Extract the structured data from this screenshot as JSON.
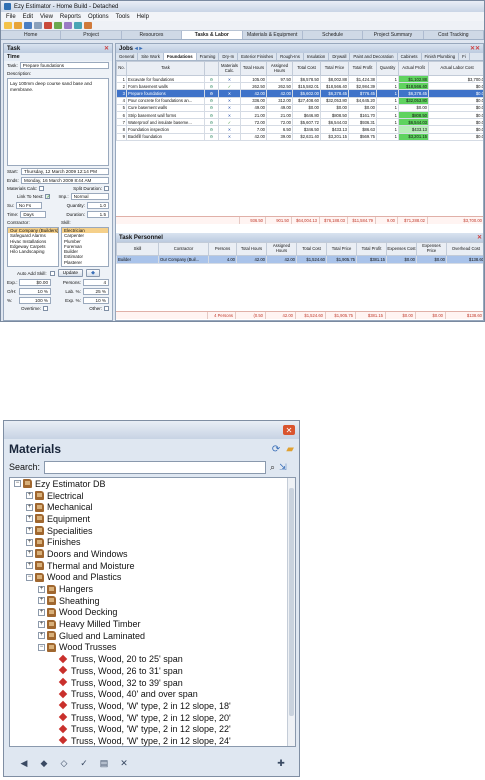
{
  "app": {
    "title": "Ezy Estimator - Home Build - Detached",
    "menu": [
      "File",
      "Edit",
      "View",
      "Reports",
      "Options",
      "Tools",
      "Help"
    ],
    "nav_tabs": [
      {
        "label": "Home",
        "active": false
      },
      {
        "label": "Project",
        "active": false
      },
      {
        "label": "Resources",
        "active": false
      },
      {
        "label": "Tasks & Labor",
        "active": true
      },
      {
        "label": "Materials & Equipment",
        "active": false
      },
      {
        "label": "Schedule",
        "active": false
      },
      {
        "label": "Project Summary",
        "active": false
      },
      {
        "label": "Cost Tracking",
        "active": false
      }
    ]
  },
  "task_panel": {
    "heading": "Task",
    "section": "Time",
    "task_label": "Task:",
    "task_value": "Prepare foundations",
    "description_label": "Description:",
    "description_value": "Lay 100mm deep course sand base and membrane.",
    "start_label": "Start:",
    "start_value": "Thursday, 12 March 2009 12:14 PM",
    "ends_label": "Ends:",
    "ends_value": "Monday, 16 March 2009 8:44 AM",
    "materials_calc_label": "Materials Calc:",
    "split_duration_label": "Split Duration:",
    "link_to_next_label": "Link To Next:",
    "imp_label": "Imp.:",
    "imp_value": "Normal",
    "su_label": "Su:",
    "su_value": "No Fs",
    "quantity_label": "Quantity:",
    "quantity_value": "1.0",
    "time_label": "Time:",
    "time_value": "Days",
    "duration_label": "Duration:",
    "duration_value": "1.5",
    "contractor_label": "Contractor:",
    "skill_label": "Skill:",
    "contractors": [
      "Our Company (Builders)",
      "Safeguard Alarms",
      "Hivac Installations",
      "Edgeway Carpets",
      "Hilo Landscaping"
    ],
    "skills": [
      "Electrician",
      "Carpenter",
      "Plumber",
      "Foreman",
      "Builder",
      "Estimator",
      "Plasterer"
    ],
    "auto_add_skill_label": "Auto Add Skill:",
    "update_label": "Update",
    "exp_label": "Exp.:",
    "exp_value": "$0.00",
    "persons_label": "Persons:",
    "persons_value": "4",
    "o_h_label": "O/H:",
    "o_h_value": "10 %",
    "lab_pct_label": "Lab. %:",
    "lab_pct_value": "25 %",
    "pct_label": "%:",
    "pct_value": "100 %",
    "exp_pct_label": "Exp. %:",
    "exp_pct_value": "10 %",
    "overtime_label": "Overtime:",
    "other_label": "Other:"
  },
  "jobs_panel": {
    "heading": "Jobs",
    "tabs": [
      "General",
      "Site Work",
      "Foundations",
      "Framing",
      "Dry-In",
      "Exterior Finishes",
      "Rough-Ins",
      "Insulation",
      "Drywall",
      "Paint and Decoration",
      "Cabinets",
      "Finish Plumbing",
      "Fi"
    ],
    "active_tab": "Foundations",
    "columns": [
      "No.",
      "Task",
      "",
      "Materials Calc.",
      "Total Hours",
      "Assigned Hours",
      "Total Cost",
      "Total Price",
      "Total Profit",
      "Quantity",
      "Actual Profit",
      "Actual Labor Cost"
    ],
    "rows": [
      {
        "no": "1",
        "task": "Excavate for foundations",
        "calc": "✕",
        "hours": "105.00",
        "assigned": "97.50",
        "cost": "$6,578.50",
        "price": "$8,002.88",
        "profit": "$1,424.38",
        "qty": "1",
        "actual_profit": "$1,102.88",
        "labor": "$3,700.0",
        "sel": false,
        "hl": "green"
      },
      {
        "no": "2",
        "task": "Form basement walls",
        "calc": "✓",
        "hours": "262.50",
        "assigned": "262.50",
        "cost": "$15,582.01",
        "price": "$18,566.40",
        "profit": "$2,984.39",
        "qty": "1",
        "actual_profit": "$18,566.40",
        "labor": "$0.0",
        "sel": false,
        "hl": "green"
      },
      {
        "no": "3",
        "task": "Prepare foundations",
        "calc": "✕",
        "hours": "42.00",
        "assigned": "42.00",
        "cost": "$5,602.00",
        "price": "$6,378.45",
        "profit": "$776.45",
        "qty": "1",
        "actual_profit": "$6,378.45",
        "labor": "$0.0",
        "sel": true,
        "hl": "green"
      },
      {
        "no": "4",
        "task": "Pour concrete for foundations an...",
        "calc": "✕",
        "hours": "336.00",
        "assigned": "312.00",
        "cost": "$27,408.60",
        "price": "$32,053.80",
        "profit": "$4,645.20",
        "qty": "1",
        "actual_profit": "$32,053.80",
        "labor": "$0.0",
        "sel": false,
        "hl": "green"
      },
      {
        "no": "5",
        "task": "Cure basement walls",
        "calc": "✕",
        "hours": "49.00",
        "assigned": "49.00",
        "cost": "$0.00",
        "price": "$0.00",
        "profit": "$0.00",
        "qty": "1",
        "actual_profit": "$0.00",
        "labor": "$0.0",
        "sel": false,
        "hl": ""
      },
      {
        "no": "6",
        "task": "Strip basement wall forms",
        "calc": "✕",
        "hours": "21.00",
        "assigned": "21.00",
        "cost": "$646.80",
        "price": "$808.50",
        "profit": "$161.70",
        "qty": "1",
        "actual_profit": "$808.50",
        "labor": "$0.0",
        "sel": false,
        "hl": "green"
      },
      {
        "no": "7",
        "task": "Waterproof and insulate baseme...",
        "calc": "✓",
        "hours": "72.00",
        "assigned": "72.00",
        "cost": "$5,607.72",
        "price": "$6,544.03",
        "profit": "$936.31",
        "qty": "1",
        "actual_profit": "$6,544.03",
        "labor": "$0.0",
        "sel": false,
        "hl": "green"
      },
      {
        "no": "8",
        "task": "Foundation inspection",
        "calc": "✕",
        "hours": "7.00",
        "assigned": "6.50",
        "cost": "$346.50",
        "price": "$433.13",
        "profit": "$86.63",
        "qty": "1",
        "actual_profit": "$433.13",
        "labor": "$0.0",
        "sel": false,
        "hl": "ltgreen"
      },
      {
        "no": "9",
        "task": "Backfill foundation",
        "calc": "✕",
        "hours": "42.00",
        "assigned": "39.00",
        "cost": "$2,631.40",
        "price": "$3,201.15",
        "profit": "$569.75",
        "qty": "1",
        "actual_profit": "$3,201.15",
        "labor": "$0.0",
        "sel": false,
        "hl": "green"
      }
    ],
    "totals": [
      "",
      "936.50",
      "901.50",
      "$64,004.13",
      "$76,188.03",
      "$11,584.79",
      "9.00",
      "$71,288.02",
      "$3,700.00"
    ]
  },
  "personnel_panel": {
    "heading": "Task Personnel",
    "columns": [
      "Skill",
      "Contractor",
      "Persons",
      "Total Hours",
      "Assigned Hours",
      "Total Cost",
      "Total Price",
      "Total Profit",
      "Expenses Cost",
      "Expenses Price",
      "Overhead Cost"
    ],
    "rows": [
      {
        "skill": "Builder",
        "contractor": "Our Company (Buil...",
        "persons": "4.00",
        "hours": "42.00",
        "assigned": "42.00",
        "cost": "$1,524.60",
        "price": "$1,905.75",
        "profit": "$381.15",
        "exp_cost": "$0.00",
        "exp_price": "$0.00",
        "overhead": "$138.60"
      }
    ],
    "totals": [
      "",
      "4 Persons",
      "(0.50",
      "42.00",
      "$1,524.60",
      "$1,905.75",
      "$381.15",
      "$0.00",
      "$0.00",
      "$138.60"
    ]
  },
  "materials": {
    "title": "Materials",
    "search_label": "Search:",
    "search_value": "",
    "tree": [
      {
        "depth": 0,
        "label": "Ezy Estimator DB",
        "exp": "−",
        "kind": "folder"
      },
      {
        "depth": 1,
        "label": "Electrical",
        "exp": "+",
        "kind": "folder"
      },
      {
        "depth": 1,
        "label": "Mechanical",
        "exp": "+",
        "kind": "folder"
      },
      {
        "depth": 1,
        "label": "Equipment",
        "exp": "+",
        "kind": "folder"
      },
      {
        "depth": 1,
        "label": "Specialities",
        "exp": "+",
        "kind": "folder"
      },
      {
        "depth": 1,
        "label": "Finishes",
        "exp": "+",
        "kind": "folder"
      },
      {
        "depth": 1,
        "label": "Doors and Windows",
        "exp": "+",
        "kind": "folder"
      },
      {
        "depth": 1,
        "label": "Thermal and Moisture",
        "exp": "+",
        "kind": "folder"
      },
      {
        "depth": 1,
        "label": "Wood and Plastics",
        "exp": "−",
        "kind": "folder"
      },
      {
        "depth": 2,
        "label": "Hangers",
        "exp": "+",
        "kind": "folder"
      },
      {
        "depth": 2,
        "label": "Sheathing",
        "exp": "+",
        "kind": "folder"
      },
      {
        "depth": 2,
        "label": "Wood Decking",
        "exp": "+",
        "kind": "folder"
      },
      {
        "depth": 2,
        "label": "Heavy Milled Timber",
        "exp": "+",
        "kind": "folder"
      },
      {
        "depth": 2,
        "label": "Glued and Laminated",
        "exp": "+",
        "kind": "folder"
      },
      {
        "depth": 2,
        "label": "Wood Trusses",
        "exp": "−",
        "kind": "folder"
      },
      {
        "depth": 3,
        "label": "Truss, Wood, 20 to 25' span",
        "exp": "",
        "kind": "item"
      },
      {
        "depth": 3,
        "label": "Truss, Wood, 26 to 31' span",
        "exp": "",
        "kind": "item"
      },
      {
        "depth": 3,
        "label": "Truss, Wood, 32 to 39' span",
        "exp": "",
        "kind": "item"
      },
      {
        "depth": 3,
        "label": "Truss, Wood, 40' and over span",
        "exp": "",
        "kind": "item"
      },
      {
        "depth": 3,
        "label": "Truss, Wood, 'W' type, 2 in 12 slope, 18'",
        "exp": "",
        "kind": "item"
      },
      {
        "depth": 3,
        "label": "Truss, Wood, 'W' type, 2 in 12 slope, 20'",
        "exp": "",
        "kind": "item"
      },
      {
        "depth": 3,
        "label": "Truss, Wood, 'W' type, 2 in 12 slope, 22'",
        "exp": "",
        "kind": "item"
      },
      {
        "depth": 3,
        "label": "Truss, Wood, 'W' type, 2 in 12 slope, 24'",
        "exp": "",
        "kind": "item"
      },
      {
        "depth": 3,
        "label": "Truss, Wood, 'W' type, 2 in 12 slope, 26'",
        "exp": "",
        "kind": "item"
      }
    ],
    "tools": [
      "◀",
      "◆",
      "◇",
      "✓",
      "▤",
      "✕",
      "✚"
    ]
  },
  "colors": {
    "selected_row": "#3f73c9",
    "profit_green": "#5fd35f",
    "totals_red": "#c0392b",
    "close_orange": "#d9542e"
  }
}
